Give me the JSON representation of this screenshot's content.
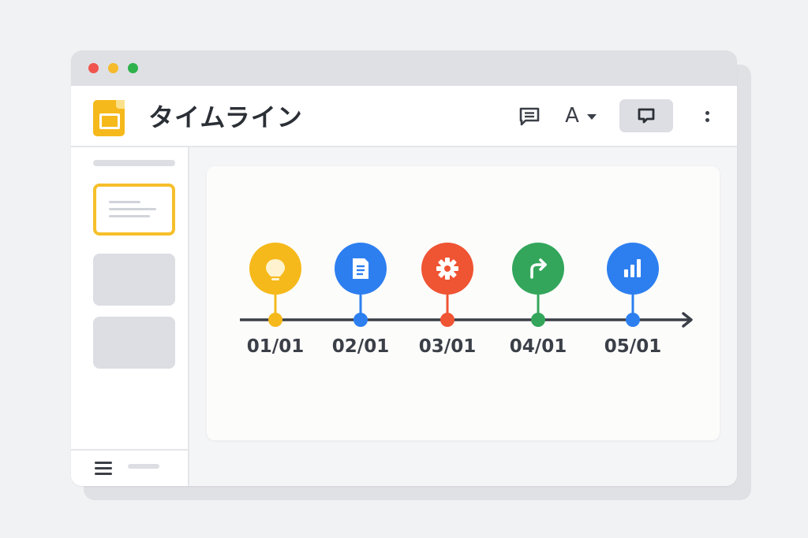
{
  "window": {
    "controls": [
      "close",
      "minimize",
      "maximize"
    ],
    "colors": {
      "close": "#f0554d",
      "minimize": "#f5bb2c",
      "maximize": "#2fb24c"
    }
  },
  "toolbar": {
    "title": "タイムライン",
    "app_icon": "slides-icon",
    "comment_icon": "comment-icon",
    "font_label": "A",
    "present_icon": "present-icon",
    "more_icon": "more-vertical-icon"
  },
  "sidebar": {
    "slides": [
      {
        "active": true
      },
      {
        "active": false
      },
      {
        "active": false
      }
    ],
    "footer_icon": "menu-icon"
  },
  "timeline": {
    "milestones": [
      {
        "date": "01/01",
        "icon": "lightbulb-icon",
        "color": "#f6b91b"
      },
      {
        "date": "02/01",
        "icon": "document-icon",
        "color": "#2d7ff0"
      },
      {
        "date": "03/01",
        "icon": "gear-icon",
        "color": "#ef5433"
      },
      {
        "date": "04/01",
        "icon": "forward-arrow-icon",
        "color": "#33a65b"
      },
      {
        "date": "05/01",
        "icon": "bar-chart-icon",
        "color": "#2d7ff0"
      }
    ]
  }
}
